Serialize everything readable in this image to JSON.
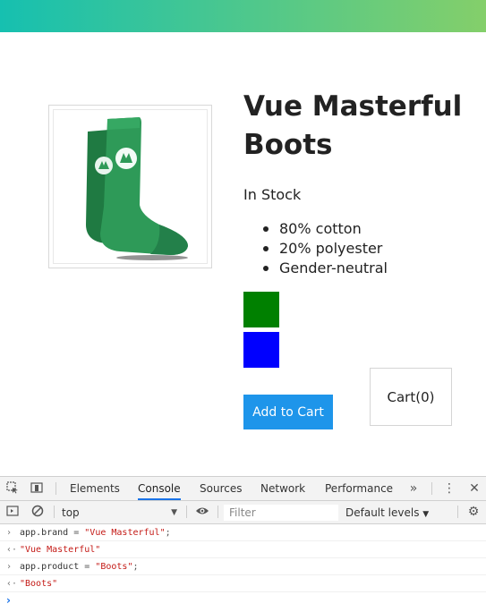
{
  "colors": {
    "nav_gradient_start": "#16c0b0",
    "nav_gradient_end": "#84cf6a",
    "accent_button": "#1e95ea"
  },
  "product": {
    "title": "Vue Masterful Boots",
    "stock": "In Stock",
    "details": [
      "80% cotton",
      "20% polyester",
      "Gender-neutral"
    ],
    "variants": [
      {
        "color": "green",
        "swatch": "#008000"
      },
      {
        "color": "blue",
        "swatch": "#0000ff"
      }
    ],
    "add_to_cart_label": "Add to Cart",
    "cart_label": "Cart(0)"
  },
  "devtools": {
    "tabs": [
      "Elements",
      "Console",
      "Sources",
      "Network",
      "Performance"
    ],
    "active_tab": "Console",
    "context": "top",
    "filter_placeholder": "Filter",
    "levels_label": "Default levels",
    "console": [
      {
        "type": "input",
        "obj": "app",
        "prop": "brand",
        "value": "\"Vue Masterful\""
      },
      {
        "type": "output",
        "value": "\"Vue Masterful\""
      },
      {
        "type": "input",
        "obj": "app",
        "prop": "product",
        "value": "\"Boots\""
      },
      {
        "type": "output",
        "value": "\"Boots\""
      }
    ]
  }
}
